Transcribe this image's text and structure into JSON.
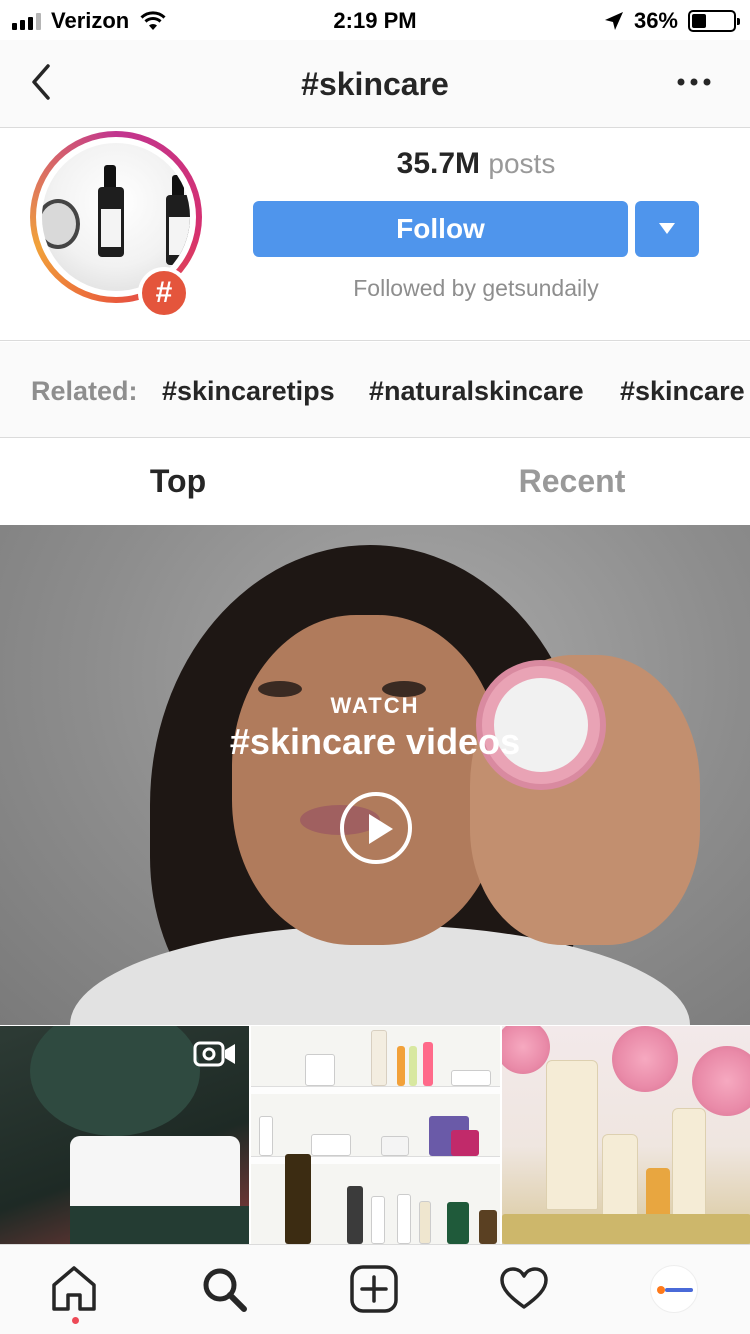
{
  "status_bar": {
    "carrier": "Verizon",
    "time": "2:19 PM",
    "battery": "36%",
    "battery_level": 0.36,
    "icons": [
      "signal-icon",
      "wifi-icon",
      "location-arrow-icon",
      "battery-icon"
    ]
  },
  "nav": {
    "title": "#skincare",
    "back_icon": "chevron-left-icon",
    "more_icon": "more-horizontal-icon"
  },
  "header": {
    "post_count": "35.7M",
    "post_label": "posts",
    "follow_label": "Follow",
    "followed_by": "Followed by getsundaily",
    "badge_symbol": "#",
    "accent_color": "#4f95ec",
    "badge_color": "#e4553c"
  },
  "related": {
    "label": "Related:",
    "tags": [
      "#skincaretips",
      "#naturalskincare",
      "#skincare"
    ]
  },
  "tabs": [
    {
      "label": "Top",
      "active": true
    },
    {
      "label": "Recent",
      "active": false
    }
  ],
  "featured": {
    "watch_label": "WATCH",
    "title": "#skincare videos",
    "play_icon": "play-circle-icon"
  },
  "grid": {
    "items": [
      {
        "type": "video",
        "icon": "video-camera-icon"
      },
      {
        "type": "photo"
      },
      {
        "type": "photo"
      }
    ]
  },
  "tabbar": {
    "items": [
      "home-icon",
      "search-icon",
      "add-post-icon",
      "heart-icon",
      "profile-avatar"
    ]
  }
}
